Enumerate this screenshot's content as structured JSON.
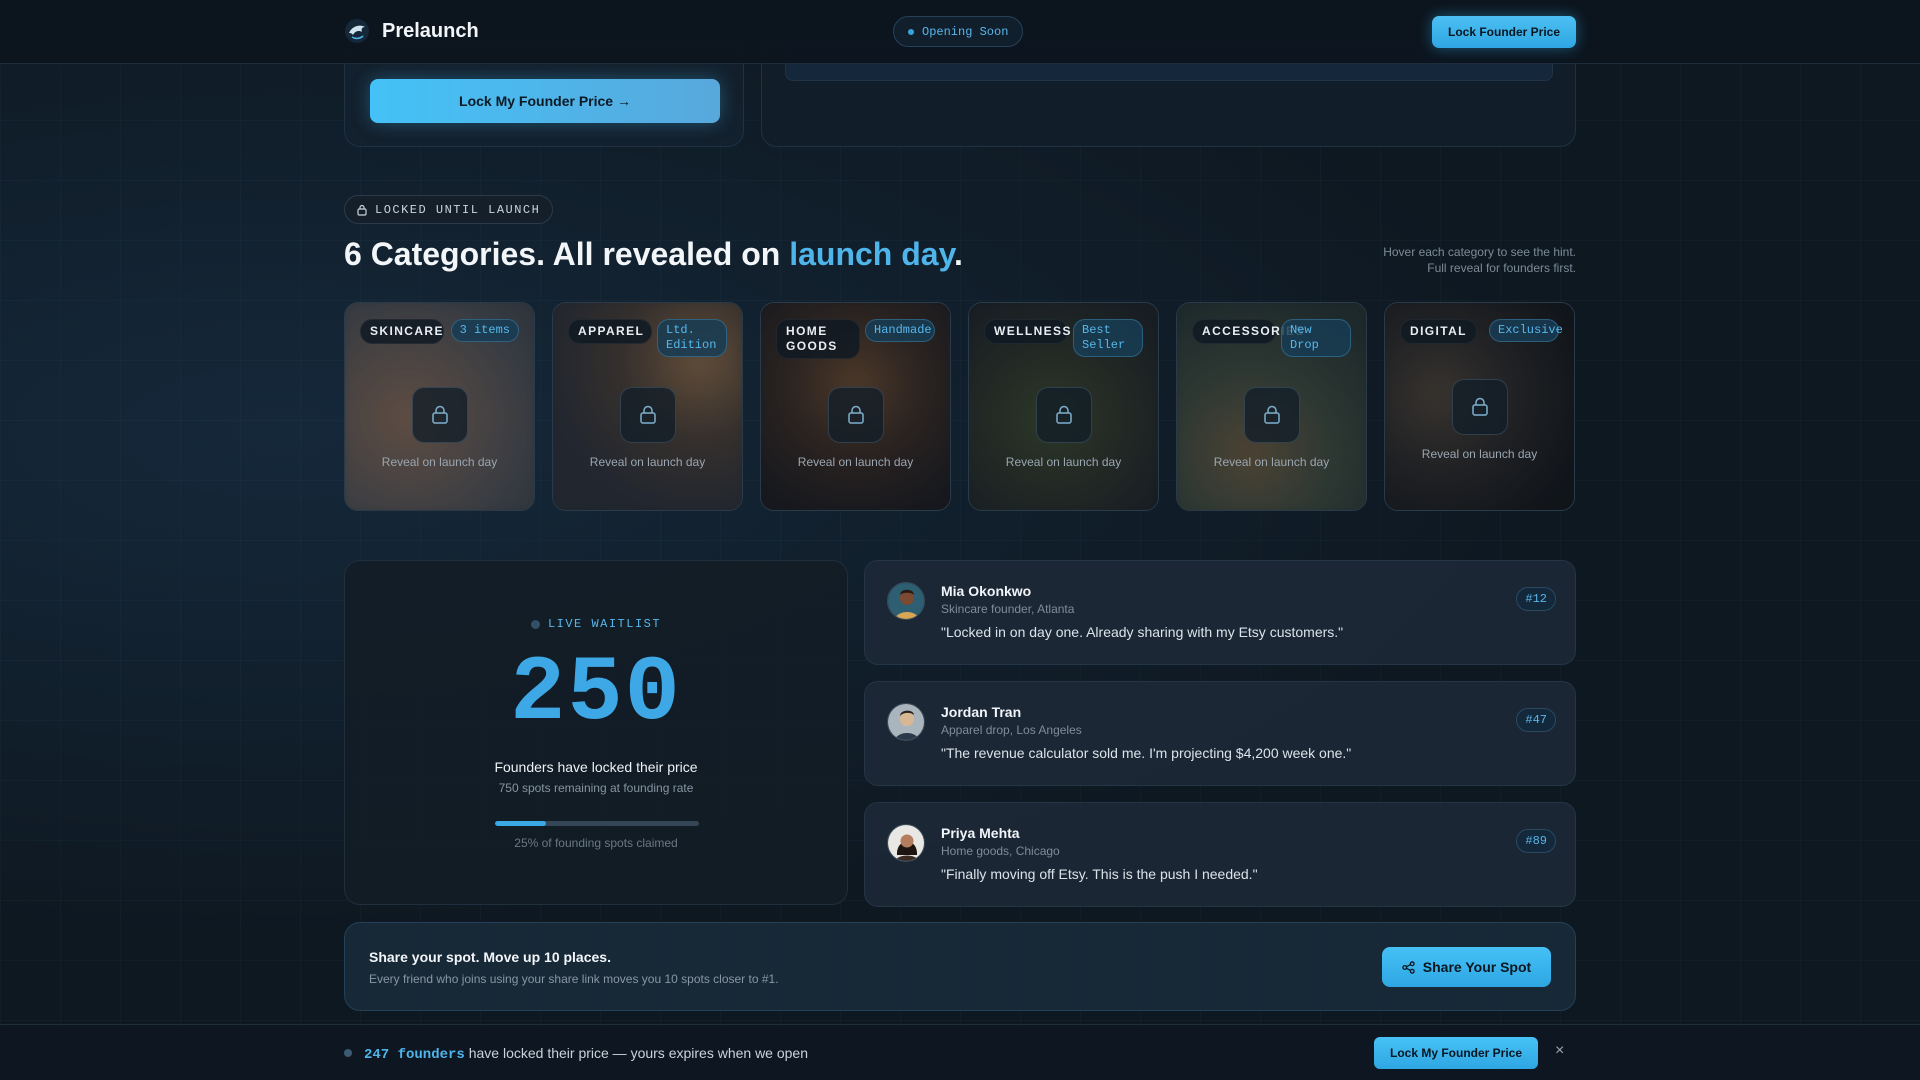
{
  "nav": {
    "brand": "Prelaunch",
    "status": "Opening Soon",
    "cta": "Lock Founder Price"
  },
  "hero": {
    "lock_button": "Lock My Founder Price →"
  },
  "categories_section": {
    "badge": "LOCKED UNTIL LAUNCH",
    "title_prefix": "6 Categories. All revealed on ",
    "title_accent": "launch day",
    "title_suffix": ".",
    "hint_line1": "Hover each category to see the hint.",
    "hint_line2": "Full reveal for founders first.",
    "items": [
      {
        "label": "SKINCARE",
        "tag": "3 items",
        "reveal": "Reveal on launch day"
      },
      {
        "label": "APPAREL",
        "tag": "Ltd. Edition",
        "reveal": "Reveal on launch day"
      },
      {
        "label": "HOME GOODS",
        "tag": "Handmade",
        "reveal": "Reveal on launch day"
      },
      {
        "label": "WELLNESS",
        "tag": "Best Seller",
        "reveal": "Reveal on launch day"
      },
      {
        "label": "ACCESSORIES",
        "tag": "New Drop",
        "reveal": "Reveal on launch day"
      },
      {
        "label": "DIGITAL",
        "tag": "Exclusive",
        "reveal": "Reveal on launch day"
      }
    ]
  },
  "waitlist": {
    "badge": "LIVE WAITLIST",
    "count": "250",
    "title": "Founders have locked their price",
    "subtitle": "750 spots remaining at founding rate",
    "progress_fraction": 0.25,
    "progress_label": "25% of founding spots claimed"
  },
  "testimonials": [
    {
      "name": "Mia Okonkwo",
      "role": "Skincare founder, Atlanta",
      "quote": "\"Locked in on day one. Already sharing with my Etsy customers.\"",
      "rank": "#12"
    },
    {
      "name": "Jordan Tran",
      "role": "Apparel drop, Los Angeles",
      "quote": "\"The revenue calculator sold me. I'm projecting $4,200 week one.\"",
      "rank": "#47"
    },
    {
      "name": "Priya Mehta",
      "role": "Home goods, Chicago",
      "quote": "\"Finally moving off Etsy. This is the push I needed.\"",
      "rank": "#89"
    }
  ],
  "share": {
    "title": "Share your spot. Move up 10 places.",
    "subtitle": "Every friend who joins using your share link moves you 10 spots closer to #1.",
    "button": "Share Your Spot"
  },
  "bottom_bar": {
    "count": "247 founders",
    "text": " have locked their price — yours expires when we open",
    "button": "Lock My Founder Price",
    "close": "×"
  },
  "colors": {
    "accent": "#3ea8e6",
    "background": "#0e1821",
    "card": "#1c2836"
  },
  "icons": {
    "brand": "dolphin-logo-icon",
    "lock": "lock-icon",
    "share": "share-icon",
    "close": "close-icon"
  }
}
